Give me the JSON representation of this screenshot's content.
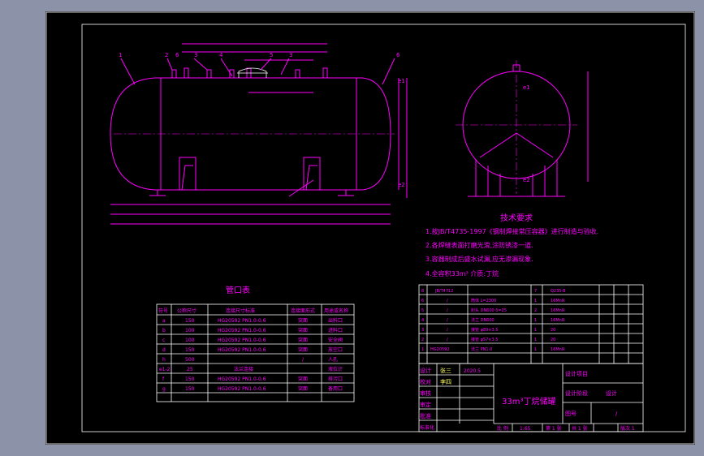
{
  "front_view": {
    "leaders": [
      "1",
      "2",
      "6",
      "3",
      "4",
      "5",
      "3",
      "6"
    ],
    "marks": [
      "e1",
      "e2"
    ]
  },
  "side_view": {
    "marks": [
      "e1",
      "e2"
    ]
  },
  "tech": {
    "title": "技术要求",
    "lines": [
      "1.按JB/T4735-1997《钢制焊接常压容器》进行制造与验收.",
      "2.各焊缝表面打磨光滑,涂防锈漆一道.",
      "3.容器制成后盛水试漏,应无渗漏现象.",
      "4.全容积33m³  介质:丁烷"
    ]
  },
  "nozzle_table": {
    "title": "管口表",
    "headers": [
      "符号",
      "公称尺寸",
      "连接尺寸标准",
      "连接面形式",
      "用途或名称"
    ],
    "rows": [
      [
        "a",
        "150",
        "HG20592 PN1.0-0.6",
        "突面",
        "出料口"
      ],
      [
        "b",
        "100",
        "HG20592 PN1.0-0.6",
        "突面",
        "进料口"
      ],
      [
        "c",
        "100",
        "HG20592 PN1.0-0.6",
        "突面",
        "安全阀"
      ],
      [
        "d",
        "150",
        "HG20592 PN1.0-0.6",
        "突面",
        "放空口"
      ],
      [
        "h",
        "500",
        "",
        "/",
        "人孔"
      ],
      [
        "e1-2",
        "25",
        "法兰连接",
        "",
        "液位计"
      ],
      [
        "f",
        "150",
        "HG20592 PN1.0-0.6",
        "突面",
        "排污口"
      ],
      [
        "g",
        "150",
        "HG20592 PN1.0-0.6",
        "突面",
        "备用口"
      ]
    ]
  },
  "parts_table": {
    "rows": [
      [
        "8",
        "JB/T4712",
        "",
        "",
        "7",
        "Q235-B",
        "",
        "",
        ""
      ],
      [
        "6",
        "/",
        "筒体 L=2300",
        "",
        "1",
        "16MnR",
        "",
        "",
        ""
      ],
      [
        "5",
        "/",
        "封头 DN600 δ=25",
        "",
        "2",
        "16MnR",
        "",
        "",
        ""
      ],
      [
        "4",
        "/",
        "法兰 DN600",
        "",
        "1",
        "16MnR",
        "",
        "",
        ""
      ],
      [
        "3",
        "/",
        "接管 φ89×3.5",
        "",
        "1",
        "20",
        "",
        "",
        ""
      ],
      [
        "2",
        "/",
        "接管 φ57×3.5",
        "",
        "1",
        "20",
        "",
        "",
        ""
      ],
      [
        "1",
        "HG20592",
        "法兰 PN1.0",
        "",
        "1",
        "16MnR",
        "",
        "",
        ""
      ]
    ]
  },
  "title_block": {
    "drawing_title": "33m³丁烷储罐",
    "labels": [
      "设计",
      "校对",
      "审核",
      "审定",
      "批准",
      "标准化"
    ],
    "scale_label": "比 例",
    "scale": "1:65",
    "sheet": "第 1 张",
    "sheets": "共 1 张",
    "version": "版次 1",
    "design_stage_label": "设计阶段",
    "design_stage": "设计",
    "drawing_no_label": "图号",
    "drawing_no": "/",
    "design_project_label": "设计项目",
    "names": [
      "张三",
      "李四"
    ],
    "date": "2020.5"
  }
}
